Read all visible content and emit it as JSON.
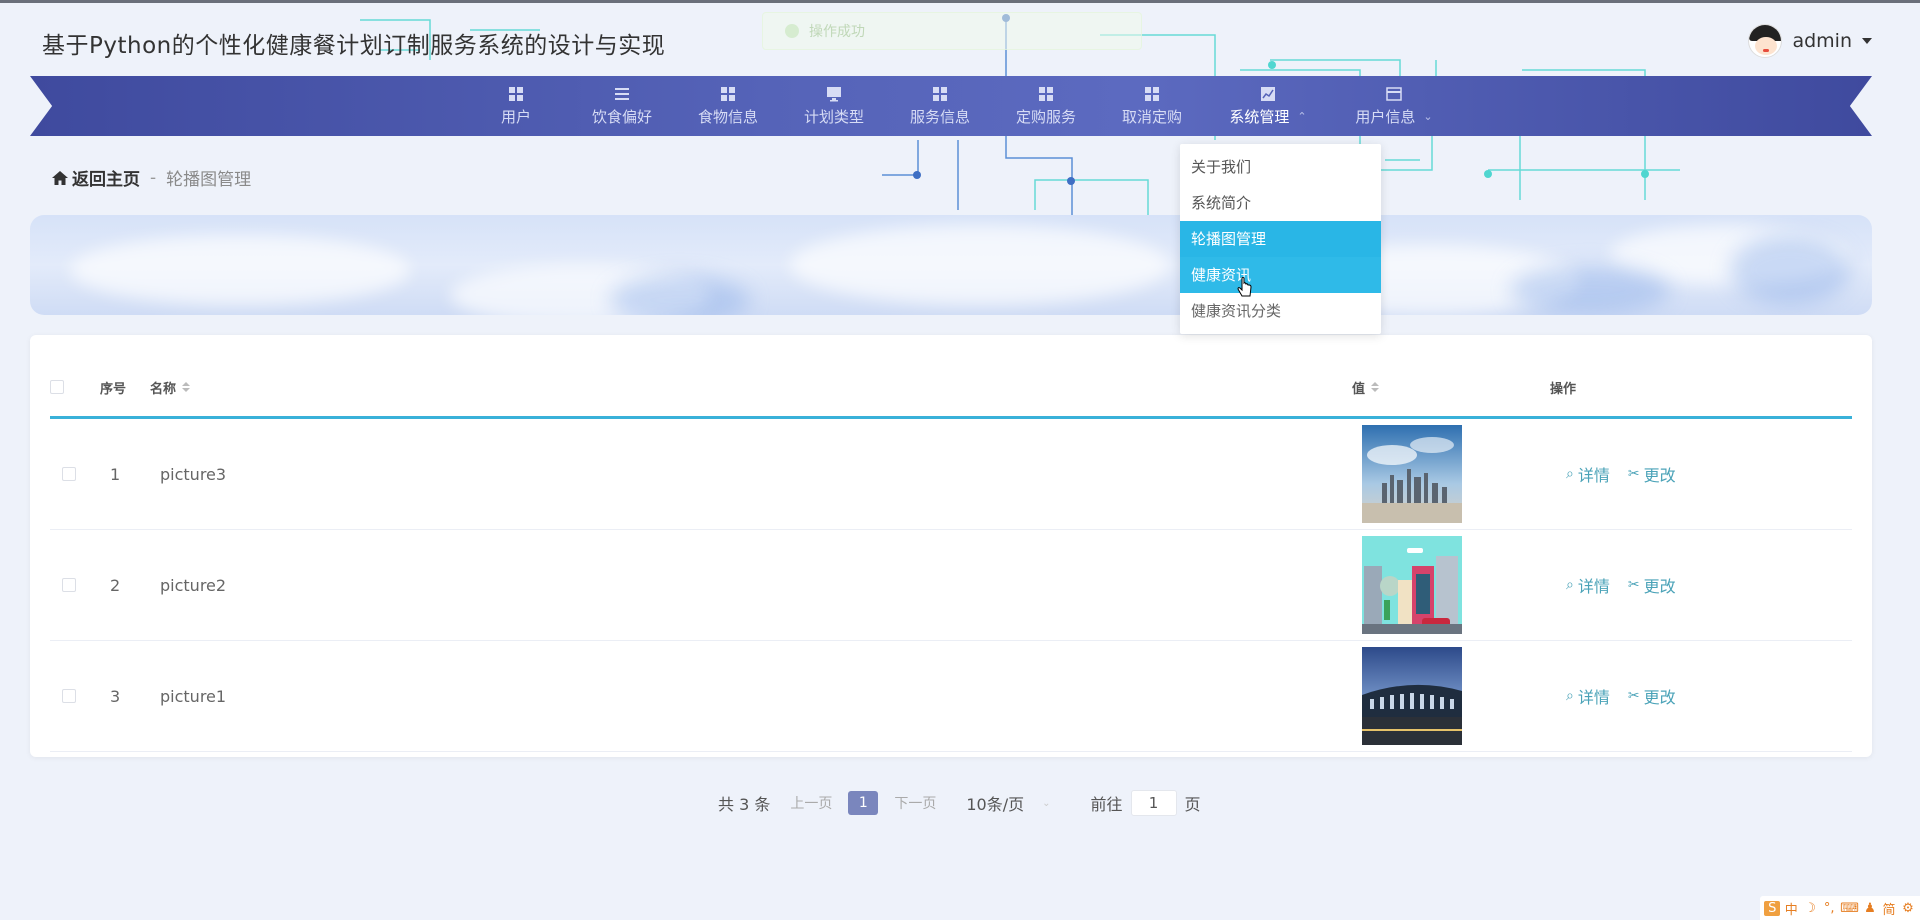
{
  "header": {
    "title": "基于Python的个性化健康餐计划订制服务系统的设计与实现",
    "username": "admin"
  },
  "toast": {
    "message": "操作成功"
  },
  "nav": {
    "items": [
      {
        "label": "用户",
        "icon": "grid-icon"
      },
      {
        "label": "饮食偏好",
        "icon": "list-icon"
      },
      {
        "label": "食物信息",
        "icon": "grid-icon"
      },
      {
        "label": "计划类型",
        "icon": "monitor-icon"
      },
      {
        "label": "服务信息",
        "icon": "grid-icon"
      },
      {
        "label": "定购服务",
        "icon": "grid-icon"
      },
      {
        "label": "取消定购",
        "icon": "grid-icon"
      },
      {
        "label": "系统管理",
        "icon": "chart-icon"
      },
      {
        "label": "用户信息",
        "icon": "card-icon"
      }
    ],
    "chevron_up": "⌃",
    "chevron_down": "⌄"
  },
  "dropdown": {
    "items": [
      {
        "label": "关于我们"
      },
      {
        "label": "系统简介"
      },
      {
        "label": "轮播图管理"
      },
      {
        "label": "健康资讯"
      },
      {
        "label": "健康资讯分类"
      }
    ]
  },
  "breadcrumb": {
    "home": "返回主页",
    "separator": "-",
    "current": "轮播图管理"
  },
  "table": {
    "columns": {
      "index": "序号",
      "name": "名称",
      "value": "值",
      "actions": "操作"
    },
    "rows": [
      {
        "index": "1",
        "name": "picture3",
        "thumb": "city-skyline"
      },
      {
        "index": "2",
        "name": "picture2",
        "thumb": "cartoon-street"
      },
      {
        "index": "3",
        "name": "picture1",
        "thumb": "building-night"
      }
    ],
    "detail_label": "详情",
    "edit_label": "更改"
  },
  "pagination": {
    "total": "共 3 条",
    "prev": "上一页",
    "current_page": "1",
    "next": "下一页",
    "page_size": "10条/页",
    "goto_prefix": "前往",
    "goto_value": "1",
    "goto_suffix": "页"
  },
  "ime": {
    "items": [
      "S",
      "中",
      "☽",
      "°,",
      "⌨",
      "♟",
      "简",
      "⚙"
    ]
  },
  "colors": {
    "nav_bg": "#4f5cb0",
    "dropdown_active": "#29b6e6",
    "table_accent": "#39b1d9",
    "action_text": "#4ba3b8",
    "page_active": "#7a86bd"
  }
}
